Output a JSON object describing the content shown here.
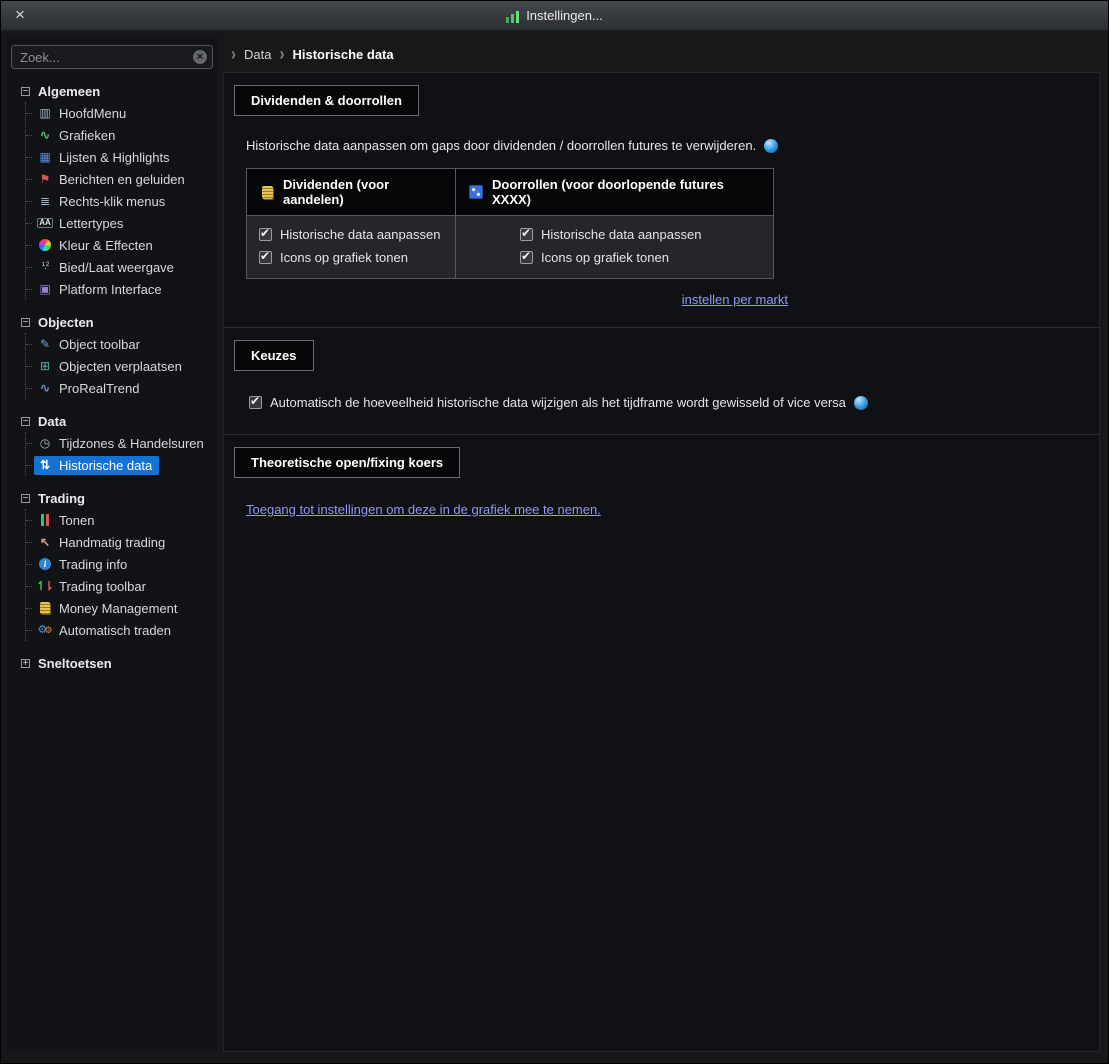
{
  "window": {
    "title": "Instellingen...",
    "close_glyph": "×"
  },
  "sidebar": {
    "search": {
      "placeholder": "Zoek...",
      "clear_glyph": "×"
    },
    "groups": [
      {
        "label": "Algemeen",
        "toggle": "−",
        "state": "expanded",
        "items": [
          {
            "label": "HoofdMenu",
            "icon": "main-menu-icon"
          },
          {
            "label": "Grafieken",
            "icon": "charts-icon"
          },
          {
            "label": "Lijsten & Highlights",
            "icon": "lists-icon"
          },
          {
            "label": "Berichten en geluiden",
            "icon": "alerts-sounds-icon"
          },
          {
            "label": "Rechts-klik menus",
            "icon": "context-menu-icon"
          },
          {
            "label": "Lettertypes",
            "icon": "fonts-icon"
          },
          {
            "label": "Kleur & Effecten",
            "icon": "colors-icon"
          },
          {
            "label": "Bied/Laat weergave",
            "icon": "bid-ask-icon"
          },
          {
            "label": "Platform Interface",
            "icon": "platform-interface-icon"
          }
        ]
      },
      {
        "label": "Objecten",
        "toggle": "−",
        "state": "expanded",
        "items": [
          {
            "label": "Object toolbar",
            "icon": "object-toolbar-icon"
          },
          {
            "label": "Objecten verplaatsen",
            "icon": "move-objects-icon"
          },
          {
            "label": "ProRealTrend",
            "icon": "prorealtrend-icon"
          }
        ]
      },
      {
        "label": "Data",
        "toggle": "−",
        "state": "expanded",
        "items": [
          {
            "label": "Tijdzones & Handelsuren",
            "icon": "timezones-icon"
          },
          {
            "label": "Historische data",
            "icon": "historical-data-icon",
            "selected": true
          }
        ]
      },
      {
        "label": "Trading",
        "toggle": "−",
        "state": "expanded",
        "items": [
          {
            "label": "Tonen",
            "icon": "display-icon"
          },
          {
            "label": "Handmatig trading",
            "icon": "manual-trading-icon"
          },
          {
            "label": "Trading info",
            "icon": "trading-info-icon"
          },
          {
            "label": "Trading toolbar",
            "icon": "trading-toolbar-icon"
          },
          {
            "label": "Money Management",
            "icon": "money-management-icon"
          },
          {
            "label": "Automatisch traden",
            "icon": "auto-trading-icon"
          }
        ]
      },
      {
        "label": "Sneltoetsen",
        "toggle": "+",
        "state": "collapsed",
        "items": []
      }
    ]
  },
  "breadcrumb": {
    "separator": "›",
    "parent": "Data",
    "current": "Historische data"
  },
  "sections": {
    "dividends": {
      "title": "Dividenden & doorrollen",
      "description": "Historische data aanpassen om gaps door dividenden / doorrollen futures te verwijderen.",
      "help_icon": "globe-help-icon",
      "columns": [
        {
          "header": "Dividenden (voor aandelen)",
          "icon": "coins-icon",
          "options": [
            {
              "label": "Historische data aanpassen",
              "checked": true
            },
            {
              "label": "Icons op grafiek tonen",
              "checked": true
            }
          ]
        },
        {
          "header": "Doorrollen (voor doorlopende futures XXXX)",
          "icon": "dice-icon",
          "options": [
            {
              "label": "Historische data aanpassen",
              "checked": true
            },
            {
              "label": "Icons op grafiek tonen",
              "checked": true
            }
          ]
        }
      ],
      "link": "instellen per markt"
    },
    "choices": {
      "title": "Keuzes",
      "label": "Automatisch de hoeveelheid historische data wijzigen als het tijdframe wordt gewisseld of vice versa",
      "checked": true,
      "help_icon": "globe-help-icon"
    },
    "theoretical": {
      "title": "Theoretische open/fixing koers",
      "link": "Toegang tot instellingen om deze in de grafiek mee te nemen."
    }
  },
  "colors": {
    "selection": "#1273d4",
    "link": "#9398f2",
    "help_icon": "#2e96e0",
    "section_tab_bg": "#060708",
    "table_header_bg": "#050607",
    "table_body_bg": "#252629"
  }
}
